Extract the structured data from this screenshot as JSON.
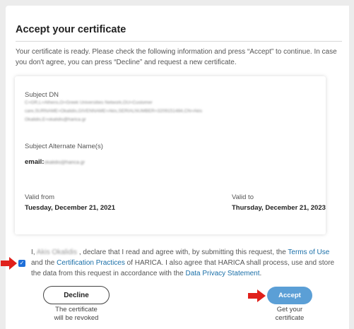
{
  "page": {
    "title": "Accept your certificate",
    "intro": "Your certificate is ready. Please check the following information and press “Accept” to continue. In case you don't agree, you can press “Decline” and request a new certificate."
  },
  "card": {
    "subject_dn_label": "Subject DN",
    "subject_dn_lines": [
      "C=GR,L=Athens,O=Greek Universities Network,OU=Customer",
      "care,SURNAME=Okalidis,GIVENNAME=Akis,SERIALNUMBER=3209151484,CN=Akis",
      "Okalidis,E=okalidis@harica.gr"
    ],
    "alt_name_label": "Subject Alternate Name(s)",
    "email_prefix": "email:",
    "email_value": "okalidis@harica.gr",
    "valid_from_label": "Valid from",
    "valid_from_value": "Tuesday, December 21, 2021",
    "valid_to_label": "Valid to",
    "valid_to_value": "Thursday, December 21, 2023"
  },
  "agreement": {
    "prefix": "I,",
    "name": "Akis Okalidis",
    "text1": ", declare that I read and agree with, by submitting this request, the",
    "terms_link": "Terms of Use",
    "text2": "and the",
    "practices_link": "Certification Practices",
    "text3": "of HARICA. I also agree that HARICA shall process, use and store the data from this request in accordance with the",
    "privacy_link": "Data Privacy Statement",
    "text4": ".",
    "checked": true
  },
  "buttons": {
    "decline_label": "Decline",
    "decline_caption_1": "The certificate",
    "decline_caption_2": "will be revoked",
    "accept_label": "Accept",
    "accept_caption_1": "Get your",
    "accept_caption_2": "certificate"
  },
  "colors": {
    "accept_button": "#5b9fd6",
    "link": "#1a6fa8",
    "annotation_arrow": "#e0201b",
    "checkbox": "#1e6fd9"
  },
  "icons": {
    "checkbox": "check-icon",
    "annotation": "red-arrow-icon"
  }
}
